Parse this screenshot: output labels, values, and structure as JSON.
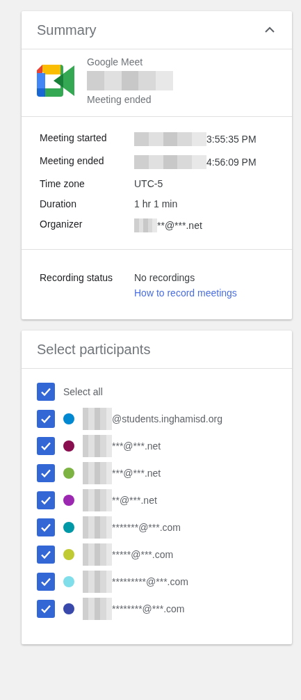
{
  "summary": {
    "title": "Summary",
    "expanded": true,
    "meeting": {
      "app": "Google Meet",
      "title_redacted": true,
      "status": "Meeting ended"
    },
    "details": [
      {
        "label": "Meeting started",
        "value": "3:55:35 PM",
        "redacted": true
      },
      {
        "label": "Meeting ended",
        "value": "4:56:09 PM",
        "redacted": true
      },
      {
        "label": "Time zone",
        "value": "UTC-5",
        "redacted": false
      },
      {
        "label": "Duration",
        "value": "1 hr 1 min",
        "redacted": false
      },
      {
        "label": "Organizer",
        "value": "**@***.net",
        "redacted": true
      }
    ],
    "recording": {
      "label": "Recording status",
      "value": "No recordings",
      "link": "How to record meetings"
    }
  },
  "participants": {
    "title": "Select participants",
    "select_all": {
      "label": "Select all",
      "checked": true
    },
    "items": [
      {
        "email": "@students.inghamisd.org",
        "color": "#0288d1",
        "checked": true
      },
      {
        "email": "***@***.net",
        "color": "#880e4f",
        "checked": true
      },
      {
        "email": "***@***.net",
        "color": "#7cb342",
        "checked": true
      },
      {
        "email": "**@***.net",
        "color": "#9c27b0",
        "checked": true
      },
      {
        "email": "*******@***.com",
        "color": "#0097a7",
        "checked": true
      },
      {
        "email": "*****@***.com",
        "color": "#c0ca33",
        "checked": true
      },
      {
        "email": "*********@***.com",
        "color": "#80deea",
        "checked": true
      },
      {
        "email": "********@***.com",
        "color": "#3949ab",
        "checked": true
      }
    ]
  }
}
